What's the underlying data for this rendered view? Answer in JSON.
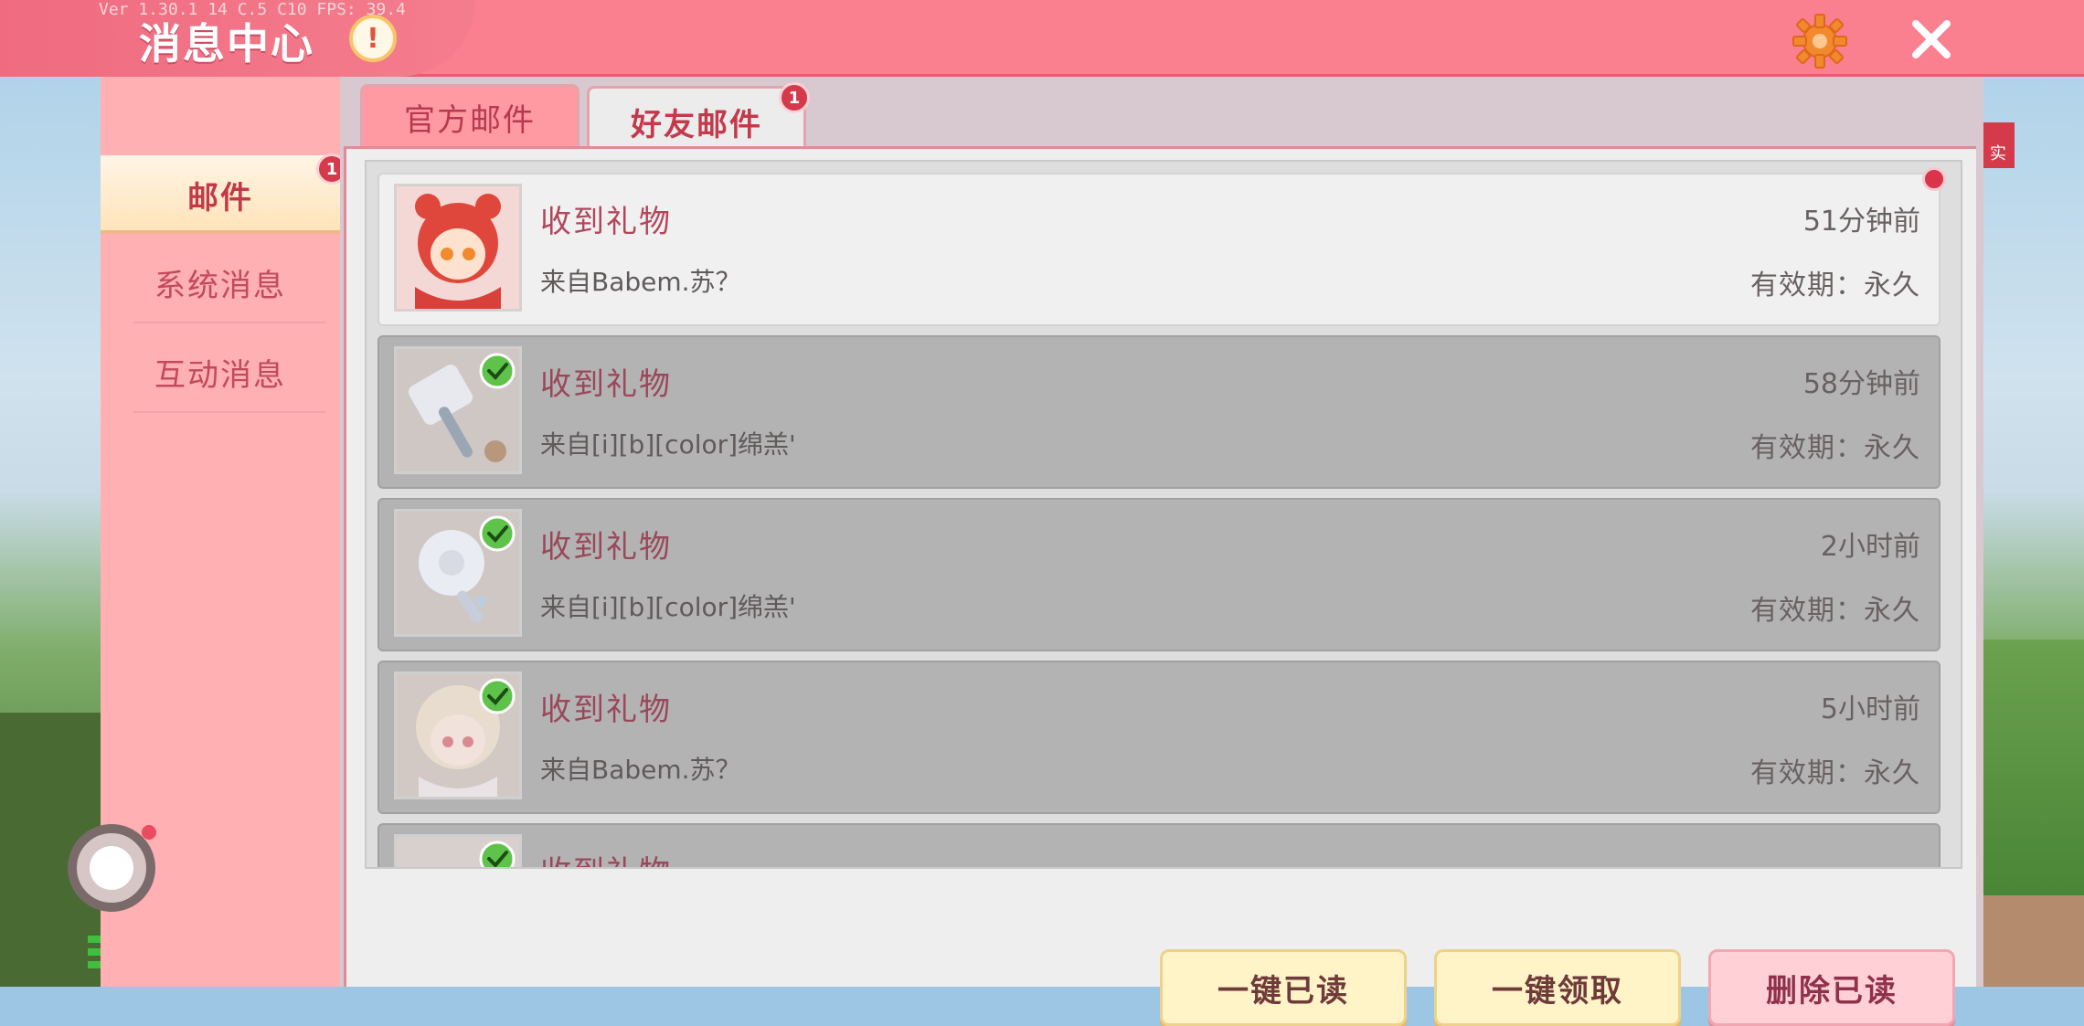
{
  "version_text": "Ver 1.30.1 14 C.5 C10 FPS: 39.4",
  "header": {
    "title": "消息中心",
    "alert_glyph": "!"
  },
  "sidebar": {
    "items": [
      {
        "label": "邮件",
        "active": true,
        "badge": "1"
      },
      {
        "label": "系统消息",
        "active": false
      },
      {
        "label": "互动消息",
        "active": false
      }
    ]
  },
  "tabs": [
    {
      "label": "官方邮件",
      "active": false
    },
    {
      "label": "好友邮件",
      "active": true,
      "badge": "1"
    }
  ],
  "mails": [
    {
      "title": "收到礼物",
      "from": "来自Babem.苏？",
      "time": "51分钟前",
      "valid": "有效期：永久",
      "read": false
    },
    {
      "title": "收到礼物",
      "from": "来自[i][b][color]绵羔'",
      "time": "58分钟前",
      "valid": "有效期：永久",
      "read": true
    },
    {
      "title": "收到礼物",
      "from": "来自[i][b][color]绵羔'",
      "time": "2小时前",
      "valid": "有效期：永久",
      "read": true
    },
    {
      "title": "收到礼物",
      "from": "来自Babem.苏？",
      "time": "5小时前",
      "valid": "有效期：永久",
      "read": true
    },
    {
      "title": "收到礼物",
      "from": "",
      "time": "",
      "valid": "",
      "read": true
    }
  ],
  "buttons": {
    "mark_all_read": "一键已读",
    "claim_all": "一键领取",
    "delete_read": "删除已读"
  },
  "side_tag": "实",
  "colors": {
    "header": "#fa7f8f",
    "accent": "#d53a4b",
    "sidebar": "#ffb0b3"
  }
}
